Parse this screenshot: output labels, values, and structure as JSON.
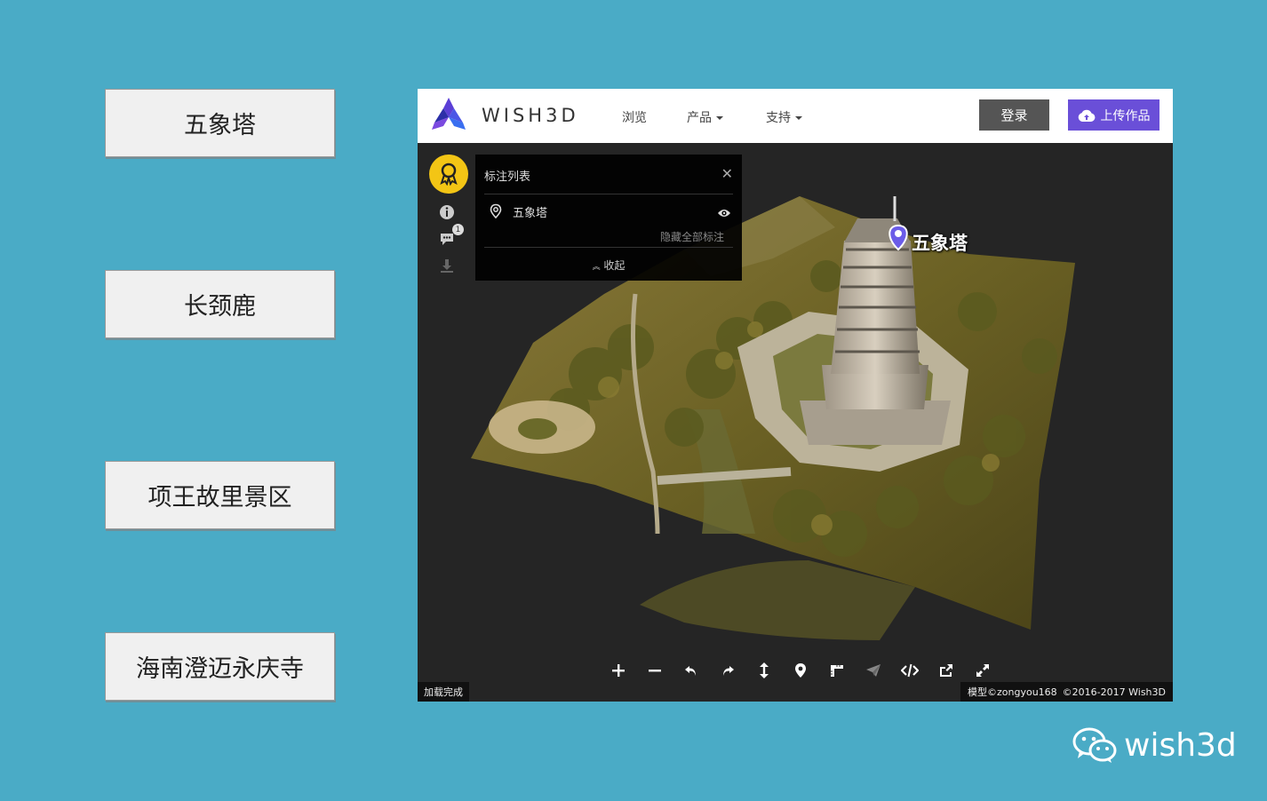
{
  "side_buttons": [
    {
      "label": "五象塔"
    },
    {
      "label": "长颈鹿"
    },
    {
      "label": "项王故里景区"
    },
    {
      "label": "海南澄迈永庆寺"
    }
  ],
  "header": {
    "brand": "WISH3D",
    "nav": [
      {
        "label": "浏览"
      },
      {
        "label": "产品"
      },
      {
        "label": "支持"
      }
    ],
    "login_label": "登录",
    "upload_label": "上传作品"
  },
  "annotation_panel": {
    "title": "标注列表",
    "items": [
      {
        "label": "五象塔"
      }
    ],
    "hide_all_label": "隐藏全部标注",
    "collapse_label": "收起"
  },
  "sidebar": {
    "comment_count": "1"
  },
  "scene": {
    "marker_label": "五象塔"
  },
  "status": {
    "left": "加载完成",
    "model_credit": "模型©zongyou168",
    "copyright": "©2016-2017 Wish3D"
  },
  "watermark": {
    "text": "wish3d"
  },
  "colors": {
    "background": "#4aabc6",
    "accent_purple": "#6a4fd8",
    "badge_yellow": "#f3c515"
  }
}
